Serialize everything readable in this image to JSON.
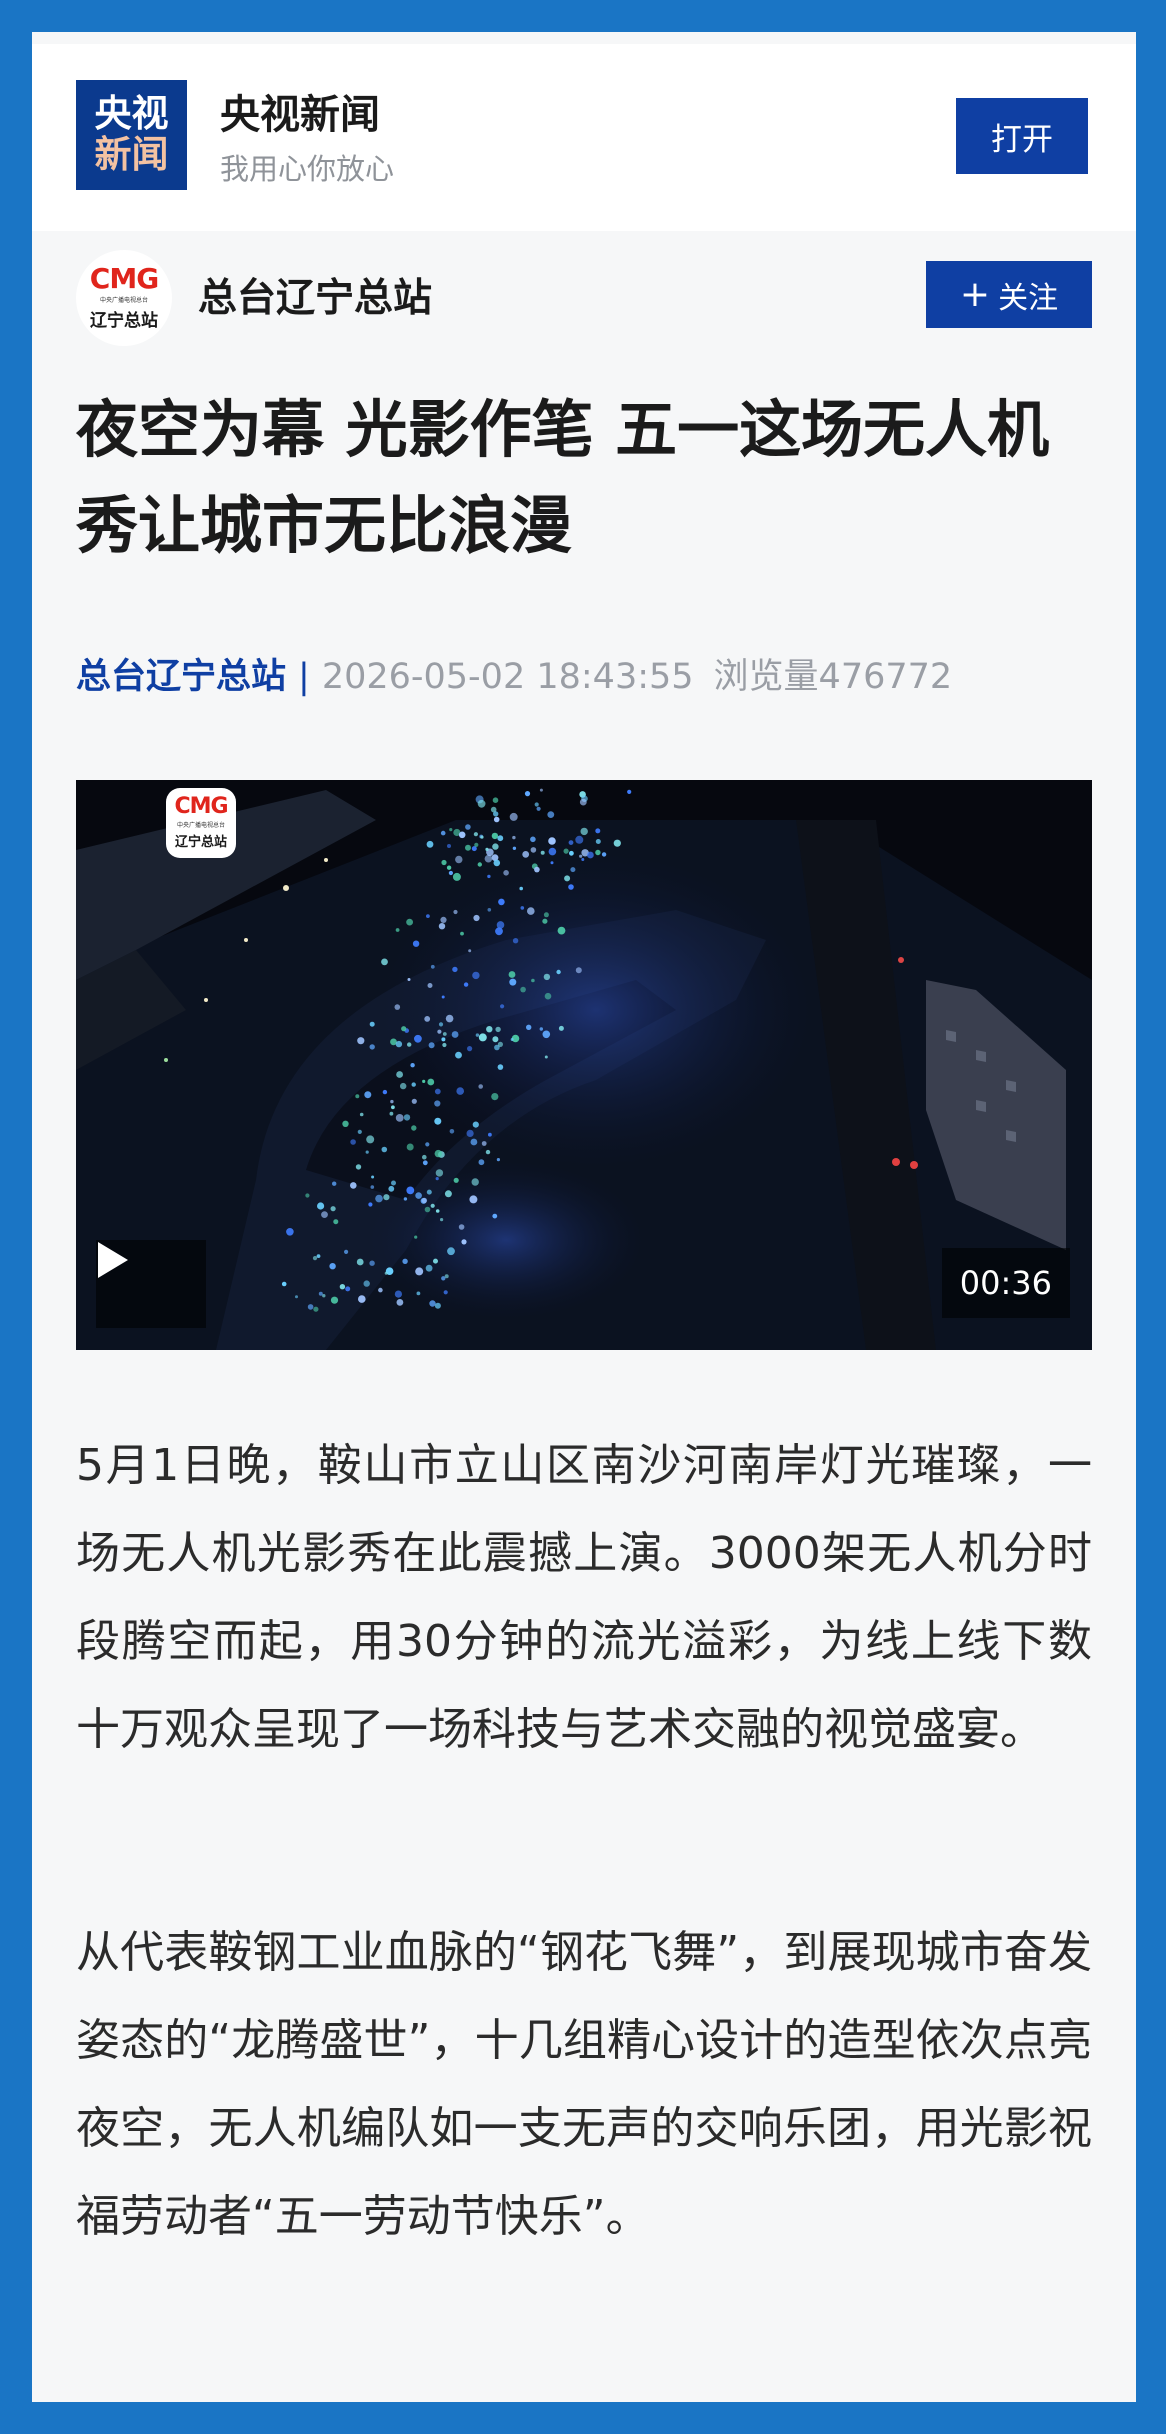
{
  "app_banner": {
    "logo_line1": "央视",
    "logo_line2": "新闻",
    "name": "央视新闻",
    "slogan": "我用心你放心",
    "open_label": "打开"
  },
  "channel": {
    "logo_brand": "CMG",
    "logo_subtitle": "中央广播电视总台",
    "logo_name": "辽宁总站",
    "name": "总台辽宁总站",
    "follow_plus": "+",
    "follow_label": "关注"
  },
  "article": {
    "title": "夜空为幕 光影作笔 五一这场无人机秀让城市无比浪漫",
    "source": "总台辽宁总站",
    "separator": "|",
    "datetime": "2026-05-02 18:43:55",
    "views": "浏览量476772",
    "paragraphs": [
      "5月1日晚，鞍山市立山区南沙河南岸灯光璀璨，一场无人机光影秀在此震撼上演。3000架无人机分时段腾空而起，用30分钟的流光溢彩，为线上线下数十万观众呈现了一场科技与艺术交融的视觉盛宴。",
      "从代表鞍钢工业血脉的“钢花飞舞”，到展现城市奋发姿态的“龙腾盛世”，十几组精心设计的造型依次点亮夜空，无人机编队如一支无声的交响乐团，用光影祝福劳动者“五一劳动节快乐”。"
    ]
  },
  "video": {
    "watermark_brand": "CMG",
    "watermark_subtitle": "中央广播电视总台",
    "watermark_name": "辽宁总站",
    "play_icon": "play-icon",
    "duration": "00:36"
  },
  "colors": {
    "outer_border": "#1a75c5",
    "accent": "#0f3fa3",
    "logo_red": "#e0251c"
  }
}
